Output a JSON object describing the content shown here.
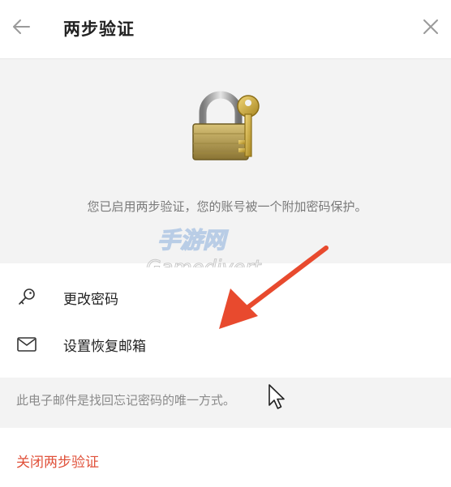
{
  "header": {
    "title": "两步验证",
    "back_icon": "arrow-left-icon",
    "close_icon": "close-icon"
  },
  "hero": {
    "icon": "padlock-key-icon",
    "description": "您已启用两步验证，您的账号被一个附加密码保护。"
  },
  "watermark": {
    "text_cn": "手游网",
    "text_en": "Gamedivert"
  },
  "menu": {
    "items": [
      {
        "label": "更改密码",
        "icon": "key-icon"
      },
      {
        "label": "设置恢复邮箱",
        "icon": "mail-icon"
      }
    ]
  },
  "note": {
    "text": "此电子邮件是找回忘记密码的唯一方式。"
  },
  "footer": {
    "disable_label": "关闭两步验证"
  },
  "colors": {
    "accent_red": "#e0513a",
    "hero_bg": "#f3f3f3"
  }
}
